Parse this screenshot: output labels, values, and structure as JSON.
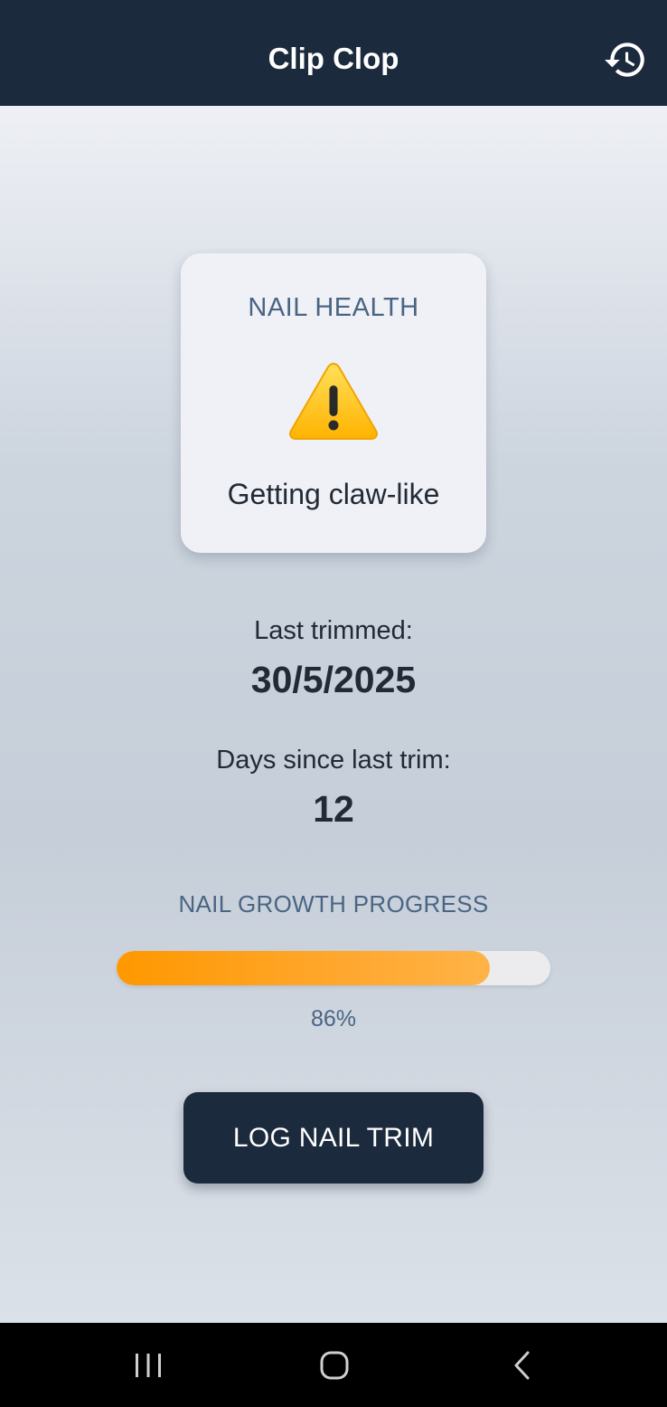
{
  "app_bar": {
    "title": "Clip Clop",
    "history_icon": "history-icon"
  },
  "health_card": {
    "title": "NAIL HEALTH",
    "icon": "warning-icon",
    "status": "Getting claw-like"
  },
  "last_trimmed": {
    "label": "Last trimmed:",
    "value": "30/5/2025"
  },
  "days_since": {
    "label": "Days since last trim:",
    "value": "12"
  },
  "growth_progress": {
    "title": "NAIL GROWTH PROGRESS",
    "percent": 86,
    "percent_label": "86%"
  },
  "log_button": {
    "label": "LOG NAIL TRIM"
  },
  "nav_bar": {
    "recents_icon": "recents-icon",
    "home_icon": "home-icon",
    "back_icon": "back-icon"
  },
  "colors": {
    "app_bar": "#1c2a3d",
    "accent_text": "#4a6583",
    "progress_fill": "#ff9800",
    "progress_track": "#ececee",
    "button": "#1c2a3d"
  }
}
